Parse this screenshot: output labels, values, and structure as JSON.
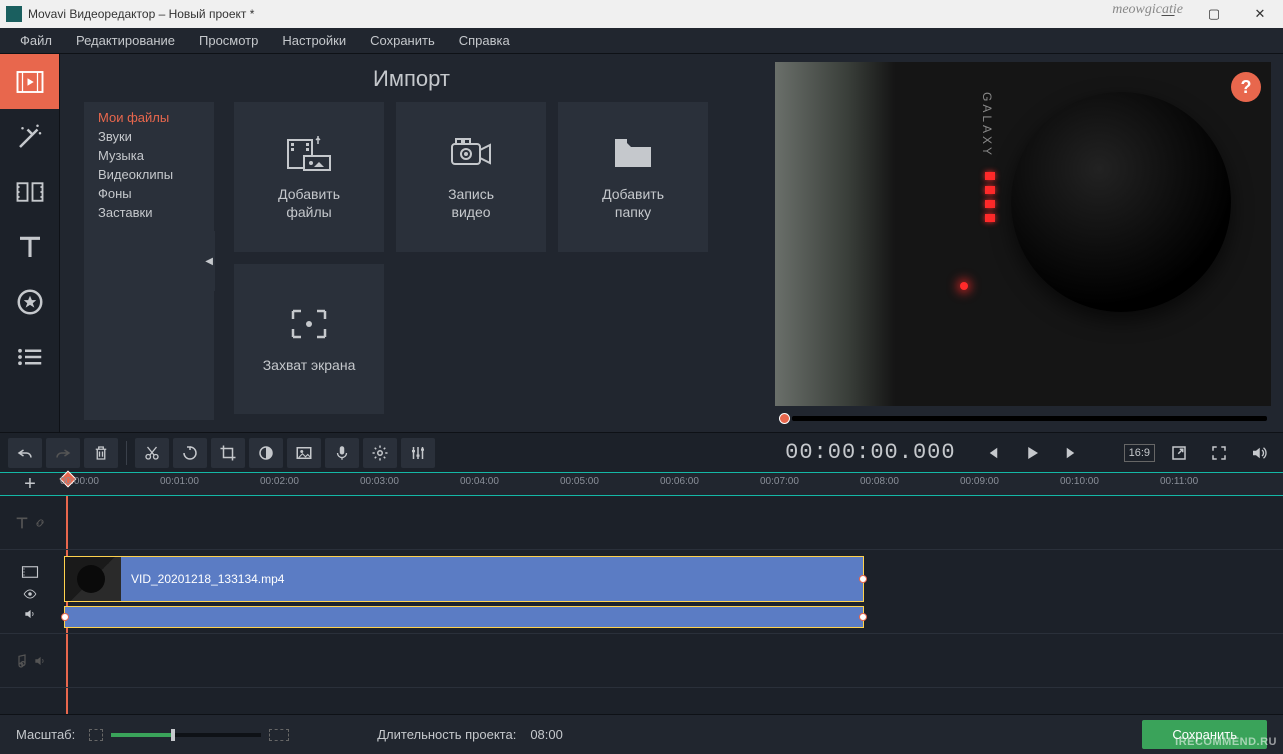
{
  "title": "Movavi Видеоредактор – Новый проект *",
  "watermark_tl": "meowgicatie",
  "watermark_br": "IRECOMMEND.RU",
  "menu": [
    "Файл",
    "Редактирование",
    "Просмотр",
    "Настройки",
    "Сохранить",
    "Справка"
  ],
  "import": {
    "title": "Импорт",
    "categories": [
      "Мои файлы",
      "Звуки",
      "Музыка",
      "Видеоклипы",
      "Фоны",
      "Заставки"
    ],
    "tiles": [
      {
        "label": "Добавить\nфайлы"
      },
      {
        "label": "Запись\nвидео"
      },
      {
        "label": "Добавить\nпапку"
      },
      {
        "label": "Захват экрана"
      }
    ]
  },
  "help_label": "?",
  "timecode": "00:00:00.000",
  "ratio": "16:9",
  "ruler_marks": [
    "00:00:00",
    "00:01:00",
    "00:02:00",
    "00:03:00",
    "00:04:00",
    "00:05:00",
    "00:06:00",
    "00:07:00",
    "00:08:00",
    "00:09:00",
    "00:10:00",
    "00:11:00"
  ],
  "clip": {
    "name": "VID_20201218_133134.mp4"
  },
  "zoom_label": "Масштаб:",
  "duration_label": "Длительность проекта:",
  "duration_value": "08:00",
  "save_label": "Сохранить",
  "preview_brand": "GALAXY"
}
